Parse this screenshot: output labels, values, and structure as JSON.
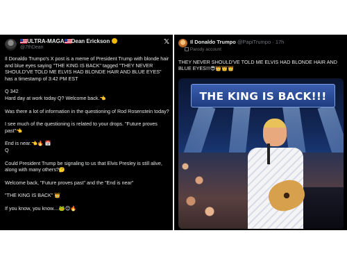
{
  "left_post": {
    "author_name": "ULTRA-MAGA",
    "author_name_2": "Dean Erickson",
    "handle": "@7thDean",
    "platform_icon": "x-logo-icon",
    "paragraphs": [
      "Il Donaldo Trumpo's X post is a meme of President Trump with blonde hair and blue eyes saying \"THE KING IS BACK\" tagged \"THEY NEVER SHOULD'VE TOLD ME ELVIS HAD BLONDE HAIR AND BLUE EYES\" has a timestamp of 3:42 PM EST",
      "Q 342",
      "Hard day at work today Q? Welcome back.👈",
      "Was there a lot of information in the questioning of  Rod Rosenstein today?",
      "I see much of the questioning is related to your drops.  \"Future proves past\"👈",
      "End is near.👈🔥 📅",
      "Q",
      "Could President Trump be signaling to us that Elvis Presley is still alive, along with many others?🤔",
      "Welcome back, \"Future proves past\" and the \"End is near\"",
      "\"THE KING IS BACK\" 👑",
      "If you know, you know....🐸😊🔥"
    ]
  },
  "right_post": {
    "author_name": "Il Donaldo Trumpo",
    "handle": "@PapiTrumpo",
    "separator": "·",
    "time": "17h",
    "account_label": "Parody account",
    "text": "THEY NEVER SHOULD'VE TOLD ME ELVIS HAD BLONDE HAIR AND BLUE EYES!!!😎👑👑👑",
    "image": {
      "banner_text": "THE KING IS BACK!!!"
    }
  },
  "colors": {
    "panel_bg": "#000000",
    "text_primary": "#e7e9ea",
    "text_secondary": "#71767b"
  }
}
